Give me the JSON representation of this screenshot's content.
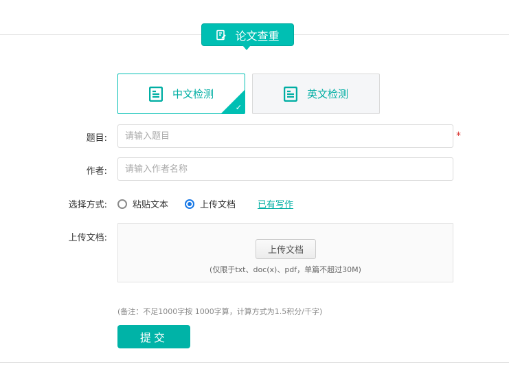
{
  "header": {
    "title": "论文查重"
  },
  "tabs": [
    {
      "label": "中文检测",
      "active": true
    },
    {
      "label": "英文检测",
      "active": false
    }
  ],
  "form": {
    "title_label": "题目:",
    "title_placeholder": "请输入题目",
    "required_mark": "*",
    "author_label": "作者:",
    "author_placeholder": "请输入作者名称",
    "method_label": "选择方式:",
    "method_options": [
      {
        "label": "粘贴文本",
        "checked": false
      },
      {
        "label": "上传文档",
        "checked": true
      }
    ],
    "existing_link": "已有写作",
    "upload_label": "上传文档:",
    "upload_button": "上传文档",
    "upload_hint": "(仅限于txt、doc(x)、pdf，单篇不超过30M)",
    "note": "(备注：不足1000字按 1000字算，计算方式为1.5积分/千字)",
    "submit": "提交"
  },
  "colors": {
    "accent": "#00bfb3",
    "radio": "#1677e6",
    "required": "#d9322d"
  }
}
